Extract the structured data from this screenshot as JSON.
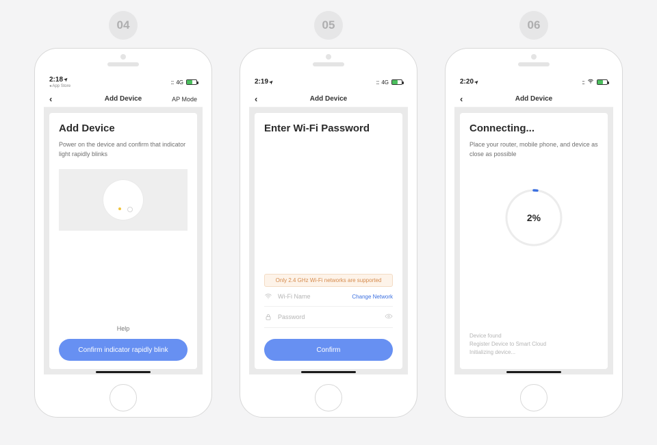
{
  "steps": {
    "s04": {
      "badge": "04",
      "statusbar": {
        "time": "2:18",
        "appstore_back": "◂ App Store",
        "carrier": "4G"
      },
      "navbar": {
        "title": "Add Device",
        "right": "AP Mode"
      },
      "heading": "Add Device",
      "description": "Power on the device and confirm that indicator light rapidly blinks",
      "help_label": "Help",
      "confirm_label": "Confirm indicator rapidly blink"
    },
    "s05": {
      "badge": "05",
      "statusbar": {
        "time": "2:19",
        "carrier": "4G"
      },
      "navbar": {
        "title": "Add Device"
      },
      "heading": "Enter Wi-Fi Password",
      "warning": "Only 2.4 GHz Wi-Fi networks are supported",
      "wifi_placeholder": "Wi-Fi Name",
      "change_network_label": "Change Network",
      "password_placeholder": "Password",
      "confirm_label": "Confirm"
    },
    "s06": {
      "badge": "06",
      "statusbar": {
        "time": "2:20"
      },
      "navbar": {
        "title": "Add Device"
      },
      "heading": "Connecting...",
      "description": "Place your router, mobile phone, and device as close as possible",
      "progress_percent": "2%",
      "progress_value": 2,
      "status_log": "Device found\nRegister Device to Smart Cloud\nInitializing device..."
    }
  },
  "icons": {
    "location_arrow": "➤",
    "signal_dots": ":::"
  }
}
